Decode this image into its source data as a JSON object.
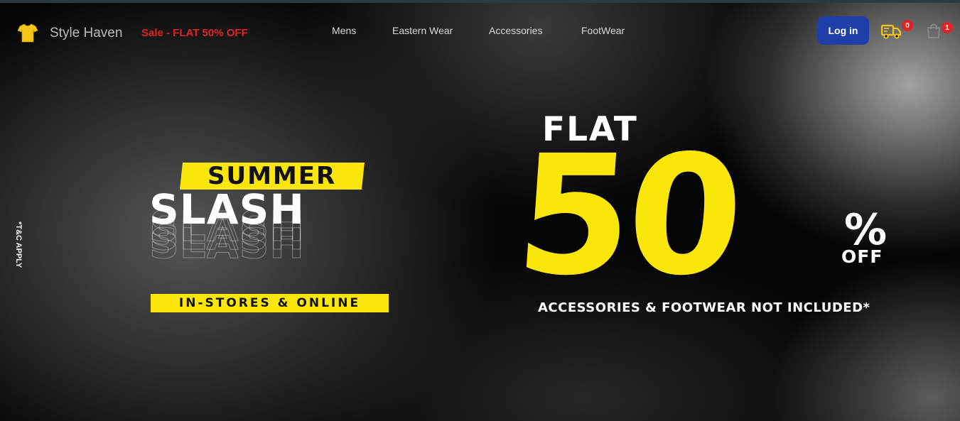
{
  "header": {
    "brand": "Style Haven",
    "sale_text": "Sale - FLAT 50% OFF",
    "nav": [
      "Mens",
      "Eastern Wear",
      "Accessories",
      "FootWear"
    ],
    "login_label": "Log in",
    "delivery_count": "0",
    "cart_count": "1",
    "logo_icon": "tshirt-icon",
    "delivery_icon": "truck-icon",
    "cart_icon": "shopping-bag-icon"
  },
  "banner": {
    "tc_note": "*T&C APPLY",
    "summer": "SUMMER",
    "slash": "SLASH",
    "stores": "IN-STORES & ONLINE",
    "flat": "FLAT",
    "discount": "50",
    "percent": "%",
    "off": "OFF",
    "exclusion": "ACCESSORIES & FOOTWEAR NOT INCLUDED*"
  },
  "colors": {
    "accent_yellow": "#fbe60a",
    "sale_red": "#e02424",
    "login_blue": "#1f3ea8"
  }
}
